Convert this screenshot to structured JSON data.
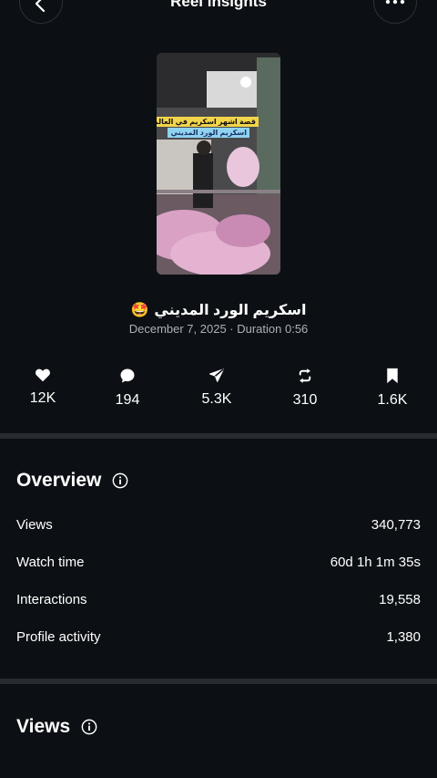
{
  "header": {
    "title": "Reel insights",
    "back_icon": "chevron-left-icon",
    "more_icon": "more-horizontal-icon"
  },
  "reel": {
    "caption_line1": "قصة اشهر اسكريم في العالم",
    "caption_line2": "اسكريم الورد المديني",
    "title": "اسكريم الورد المديني",
    "title_emoji": "🤩",
    "date": "December 7, 2025",
    "duration": "Duration 0:56",
    "meta": "December 7, 2025 · Duration 0:56"
  },
  "stats": [
    {
      "icon": "heart-icon",
      "value": "12K"
    },
    {
      "icon": "comment-icon",
      "value": "194"
    },
    {
      "icon": "share-icon",
      "value": "5.3K"
    },
    {
      "icon": "repost-icon",
      "value": "310"
    },
    {
      "icon": "bookmark-icon",
      "value": "1.6K"
    }
  ],
  "overview": {
    "title": "Overview",
    "info_icon": "info-icon",
    "rows": [
      {
        "label": "Views",
        "value": "340,773"
      },
      {
        "label": "Watch time",
        "value": "60d 1h 1m 35s"
      },
      {
        "label": "Interactions",
        "value": "19,558"
      },
      {
        "label": "Profile activity",
        "value": "1,380"
      }
    ]
  },
  "views_section": {
    "title": "Views",
    "info_icon": "info-icon"
  },
  "colors": {
    "background": "#0c1014",
    "text": "#ffffff",
    "muted": "#a8b0ba",
    "divider": "#262b31"
  }
}
